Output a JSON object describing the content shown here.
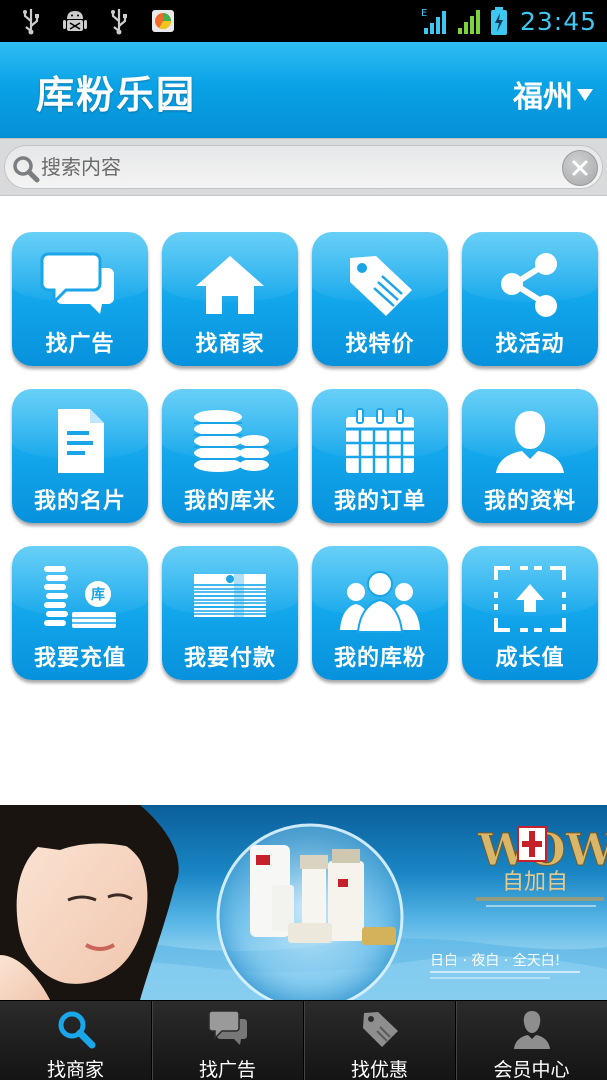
{
  "status_bar": {
    "icons": [
      "usb-icon",
      "android-debug-icon",
      "usb-icon",
      "app-notification-icon"
    ],
    "network_label": "E",
    "time": "23:45"
  },
  "header": {
    "title": "库粉乐园",
    "city": "福州"
  },
  "search": {
    "placeholder": "搜索内容"
  },
  "grid": {
    "items": [
      {
        "label": "找广告",
        "icon": "chat-bubbles-icon"
      },
      {
        "label": "找商家",
        "icon": "home-icon"
      },
      {
        "label": "找特价",
        "icon": "price-tag-icon"
      },
      {
        "label": "找活动",
        "icon": "share-icon"
      },
      {
        "label": "我的名片",
        "icon": "document-icon"
      },
      {
        "label": "我的库米",
        "icon": "coins-stack-icon"
      },
      {
        "label": "我的订单",
        "icon": "calendar-icon"
      },
      {
        "label": "我的资料",
        "icon": "person-icon"
      },
      {
        "label": "我要充值",
        "icon": "recharge-coins-icon"
      },
      {
        "label": "我要付款",
        "icon": "cash-stack-icon"
      },
      {
        "label": "我的库粉",
        "icon": "group-icon"
      },
      {
        "label": "成长值",
        "icon": "upload-frame-icon"
      }
    ],
    "recharge_badge": "库"
  },
  "banner": {
    "brand": "WOW",
    "brand_cn": "自加自",
    "slogan": "日白 · 夜白 · 全天白!"
  },
  "bottom_nav": {
    "items": [
      {
        "label": "找商家",
        "icon": "search-icon",
        "active": true
      },
      {
        "label": "找广告",
        "icon": "chat-bubbles-icon",
        "active": false
      },
      {
        "label": "找优惠",
        "icon": "price-tag-icon",
        "active": false
      },
      {
        "label": "会员中心",
        "icon": "person-icon",
        "active": false
      }
    ]
  },
  "colors": {
    "accent": "#0aa2e6",
    "tile_top": "#3ec2f5",
    "tile_bottom": "#0791dc",
    "status_time": "#3ec7f0",
    "nav_active_icon": "#1aa7ea"
  }
}
